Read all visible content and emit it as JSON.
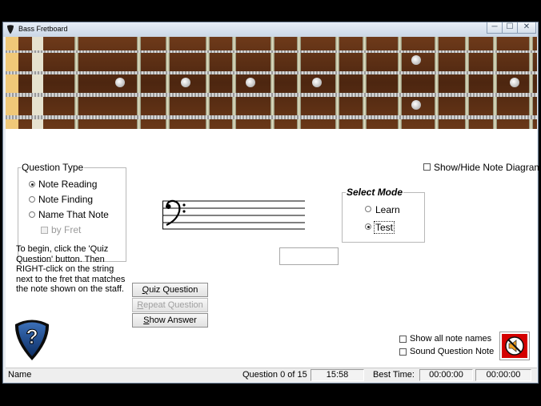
{
  "window": {
    "title": "Bass Fretboard",
    "controls": {
      "minimize": "─",
      "maximize": "☐",
      "close": "✕"
    }
  },
  "question_type": {
    "legend": "Question Type",
    "options": [
      {
        "label": "Note Reading",
        "selected": true
      },
      {
        "label": "Note Finding",
        "selected": false
      },
      {
        "label": "Name That Note",
        "selected": false
      }
    ],
    "by_fret": {
      "label": "by Fret",
      "checked": false,
      "enabled": false
    }
  },
  "instructions": [
    "To begin, click the 'Quiz",
    "Question' button. Then",
    "RIGHT-click on the string",
    "next to the fret that matches",
    "the note shown on the staff."
  ],
  "show_hide_diagram": {
    "label": "Show/Hide Note Diagram",
    "checked": false
  },
  "select_mode": {
    "legend": "Select Mode",
    "options": [
      {
        "label": "Learn",
        "selected": false
      },
      {
        "label": "Test",
        "selected": true
      }
    ]
  },
  "answer_input": {
    "value": ""
  },
  "buttons": {
    "quiz": {
      "underline": "Q",
      "rest": "uiz Question",
      "enabled": true
    },
    "repeat": {
      "underline": "R",
      "rest": "epeat Question",
      "enabled": false
    },
    "show_answer": {
      "underline": "S",
      "rest": "how Answer",
      "enabled": true
    }
  },
  "options": {
    "show_all_note_names": {
      "label": "Show all note names",
      "checked": false
    },
    "sound_question_note": {
      "label": "Sound Question Note",
      "checked": false
    }
  },
  "icons": {
    "help": "help-pick-icon",
    "sound": "sound-off-icon",
    "clef": "bass-clef-icon"
  },
  "status": {
    "name": "Name",
    "question": "Question 0 of 15",
    "clock": "15:58",
    "best_time_label": "Best Time:",
    "best_time": "00:00:00",
    "elapsed": "00:00:00"
  },
  "colors": {
    "fretboard_wood": "#5a2e14",
    "fret_metal": "#c9c7a8",
    "nut": "#f0c878",
    "sound_icon_bg": "#d40000"
  }
}
